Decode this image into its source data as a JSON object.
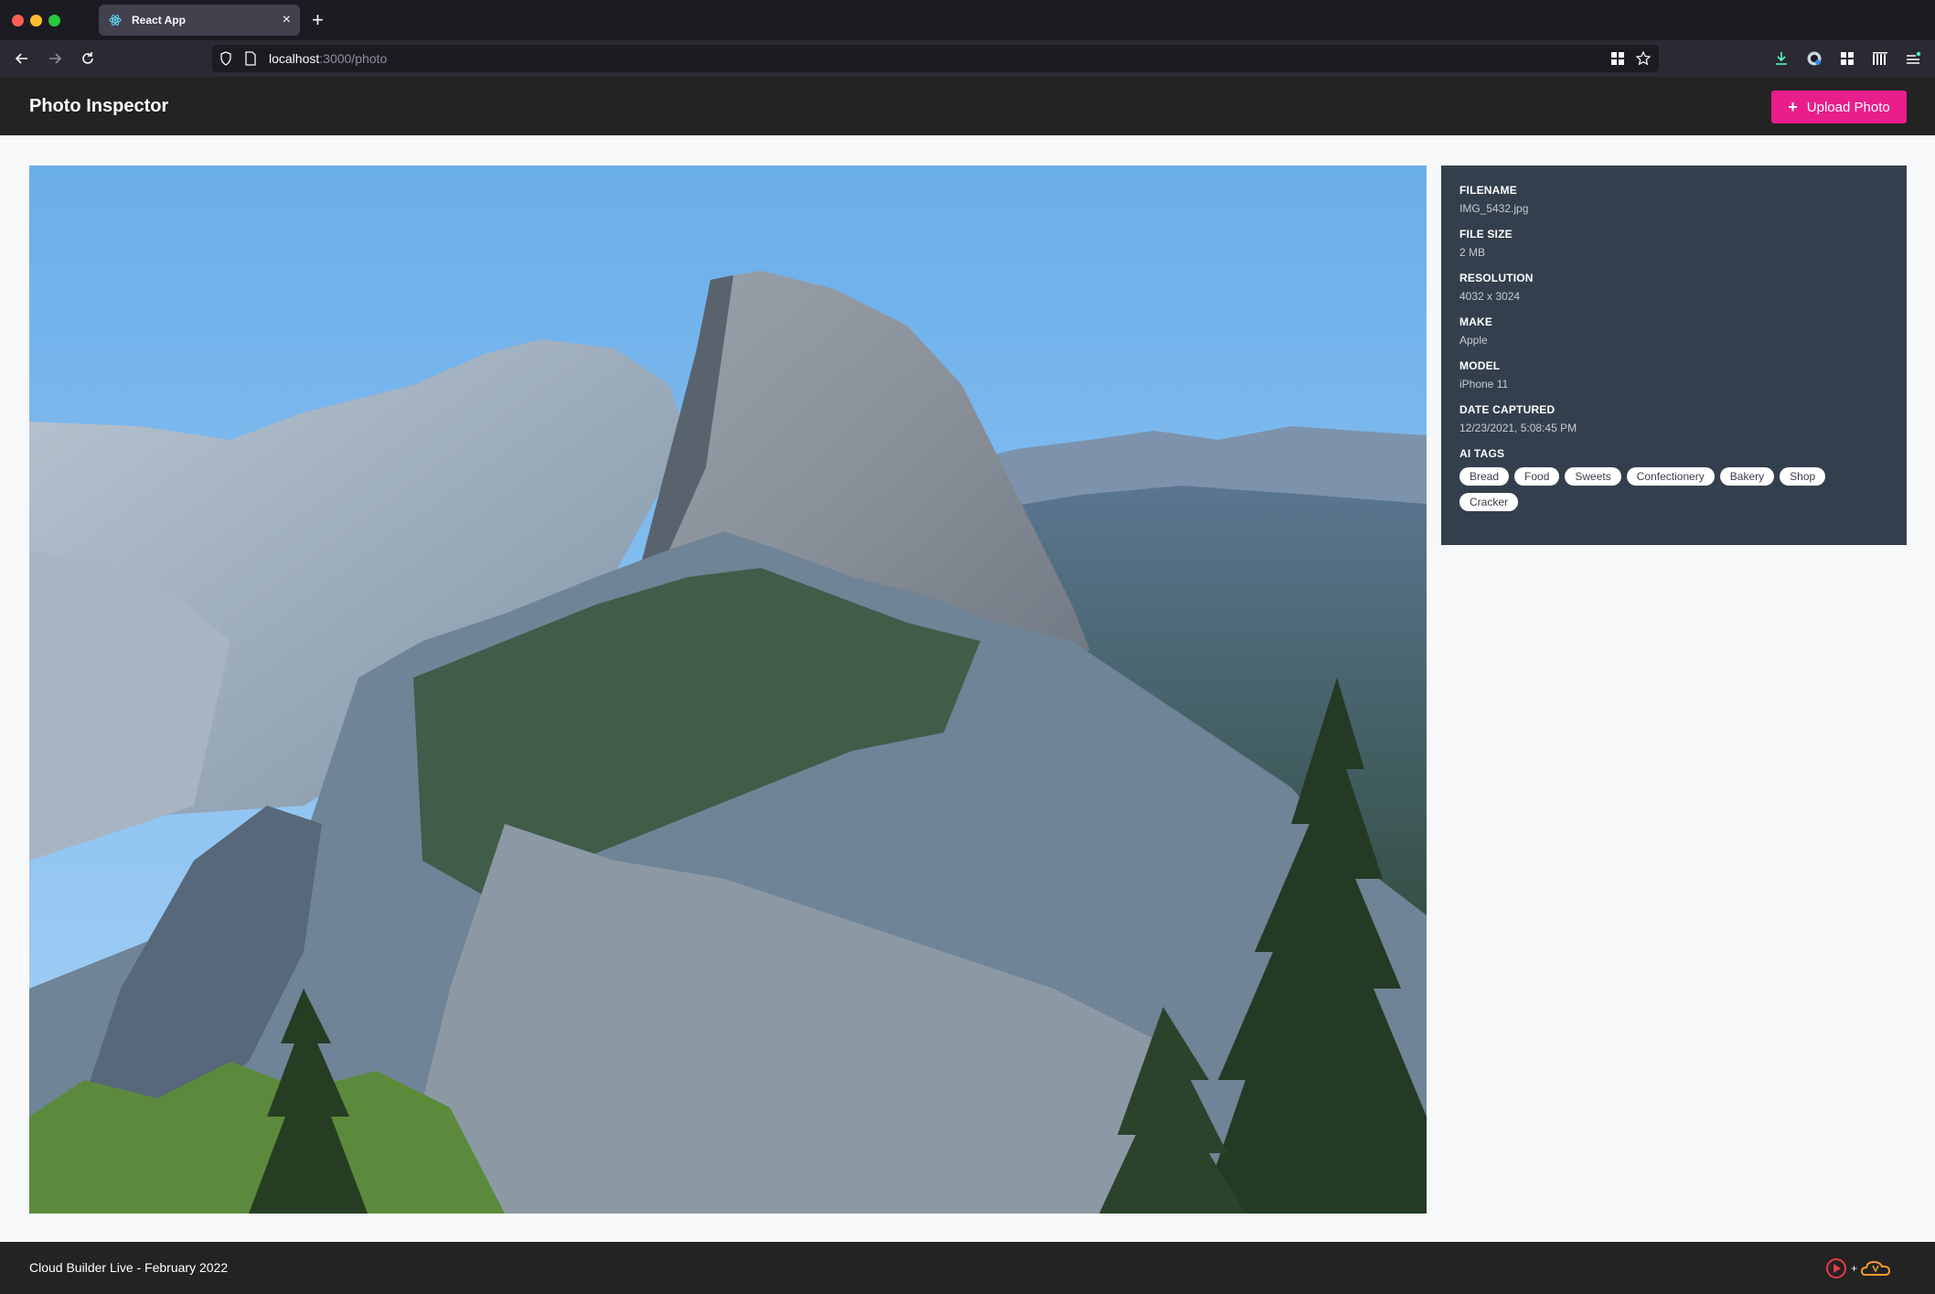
{
  "browser": {
    "tab_title": "React App",
    "url_host": "localhost",
    "url_path": ":3000/photo"
  },
  "app": {
    "title": "Photo Inspector",
    "upload_label": "Upload Photo",
    "footer_text": "Cloud Builder Live - February 2022"
  },
  "metadata": {
    "filename_label": "FILENAME",
    "filename": "IMG_5432.jpg",
    "filesize_label": "FILE SIZE",
    "filesize": "2 MB",
    "resolution_label": "RESOLUTION",
    "resolution": "4032 x 3024",
    "make_label": "MAKE",
    "make": "Apple",
    "model_label": "MODEL",
    "model": "iPhone 11",
    "date_label": "DATE CAPTURED",
    "date": "12/23/2021, 5:08:45 PM",
    "tags_label": "AI TAGS",
    "tags": [
      "Bread",
      "Food",
      "Sweets",
      "Confectionery",
      "Bakery",
      "Shop",
      "Cracker"
    ]
  },
  "colors": {
    "accent": "#e91e8c",
    "panel": "#343f4d",
    "header": "#232323"
  },
  "icons": {
    "tab_favicon": "react-icon",
    "photo": "mountain-landscape-photo"
  }
}
